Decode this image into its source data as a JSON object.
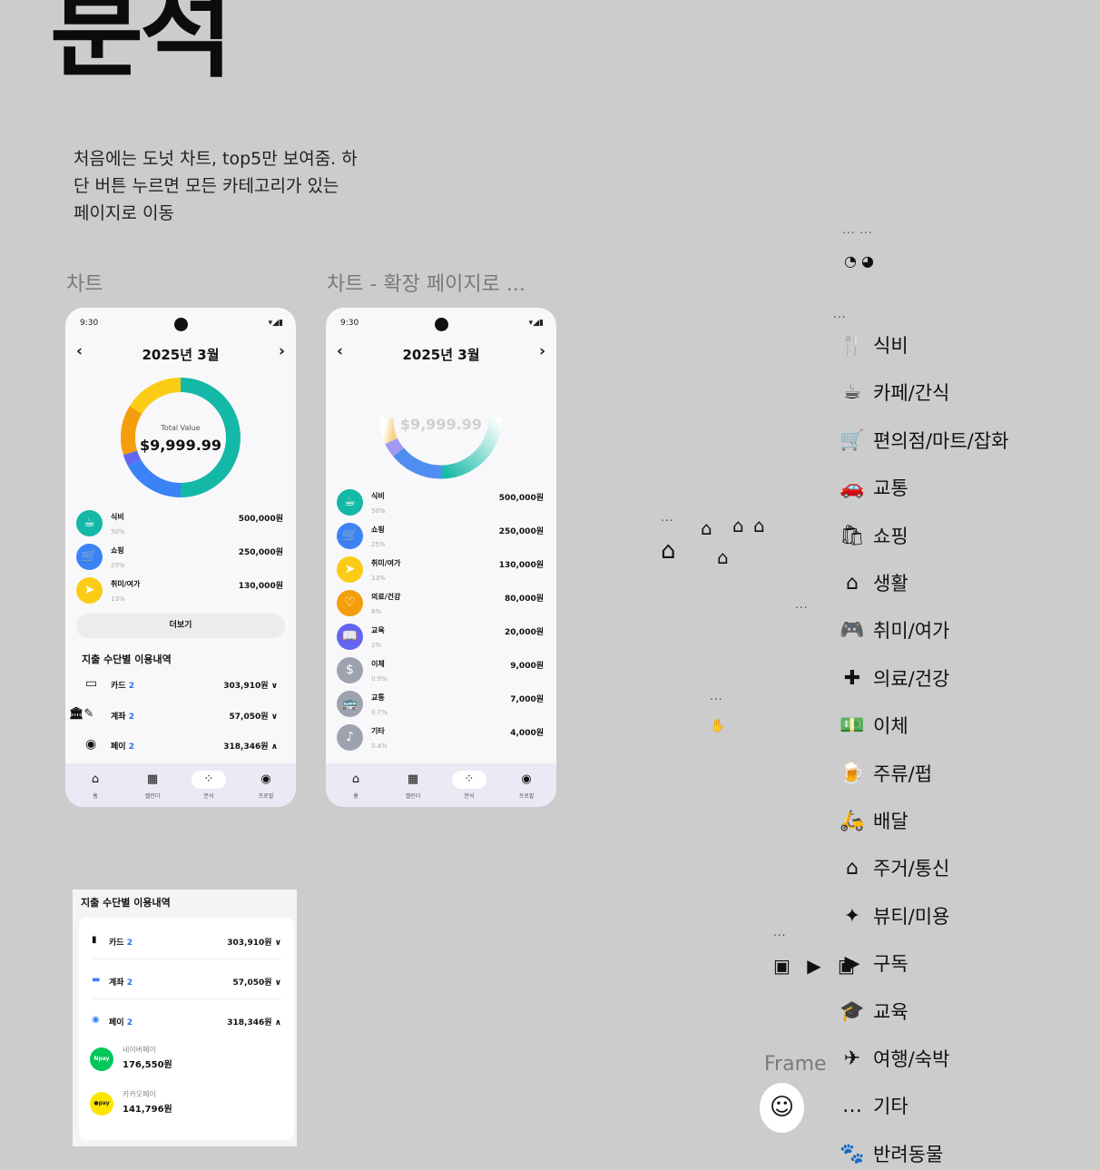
{
  "page": {
    "title": "분석",
    "description": "처음에는 도넛 차트, top5만 보여줌. 하\n단 버튼 누르면 모든 카테고리가 있는\n페이지로 이동",
    "frame1_label": "차트",
    "frame2_label": "차트 - 확장 페이지로 ...",
    "frame3_label": "Frame"
  },
  "status_bar": {
    "time": "9:30",
    "signal": "▾◢▮"
  },
  "screen1": {
    "month_title": "2025년 3월",
    "total_label": "Total Value",
    "total_value": "$9,999.99",
    "categories": [
      {
        "name": "식비",
        "percent": "50%",
        "amount": "500,000원",
        "color": "#14b8a6",
        "icon": "coffee-cup-icon",
        "glyph": "☕"
      },
      {
        "name": "쇼핑",
        "percent": "25%",
        "amount": "250,000원",
        "color": "#3b82f6",
        "icon": "cart-icon",
        "glyph": "🛒"
      },
      {
        "name": "취미/여가",
        "percent": "13%",
        "amount": "130,000원",
        "color": "#facc15",
        "icon": "send-icon",
        "glyph": "➤"
      }
    ],
    "more_button": "더보기",
    "payment_section_title": "지출 수단별 이용내역",
    "payments": [
      {
        "label": "카드",
        "count": "2",
        "amount": "303,910원",
        "chevron": "∨",
        "icon": "card-icon",
        "glyph": "▭"
      },
      {
        "label": "계좌",
        "count": "2",
        "amount": "57,050원",
        "chevron": "∨",
        "icon": "bank-icon",
        "glyph": "🏛"
      },
      {
        "label": "페이",
        "count": "2",
        "amount": "318,346원",
        "chevron": "∧",
        "icon": "pay-icon",
        "glyph": "◉"
      }
    ]
  },
  "screen2": {
    "month_title": "2025년 3월",
    "total_value": "$9,999.99",
    "categories": [
      {
        "name": "식비",
        "percent": "50%",
        "amount": "500,000원",
        "color": "#14b8a6",
        "icon": "coffee-cup-icon",
        "glyph": "☕"
      },
      {
        "name": "쇼핑",
        "percent": "25%",
        "amount": "250,000원",
        "color": "#3b82f6",
        "icon": "cart-icon",
        "glyph": "🛒"
      },
      {
        "name": "취미/여가",
        "percent": "13%",
        "amount": "130,000원",
        "color": "#facc15",
        "icon": "send-icon",
        "glyph": "➤"
      },
      {
        "name": "의료/건강",
        "percent": "8%",
        "amount": "80,000원",
        "color": "#f59e0b",
        "icon": "heart-icon",
        "glyph": "♡"
      },
      {
        "name": "교육",
        "percent": "2%",
        "amount": "20,000원",
        "color": "#6366f1",
        "icon": "book-icon",
        "glyph": "📖"
      },
      {
        "name": "이체",
        "percent": "0.9%",
        "amount": "9,000원",
        "color": "#9ca3af",
        "icon": "dollar-icon",
        "glyph": "$"
      },
      {
        "name": "교통",
        "percent": "0.7%",
        "amount": "7,000원",
        "color": "#9ca3af",
        "icon": "bus-icon",
        "glyph": "🚌"
      },
      {
        "name": "기타",
        "percent": "0.4%",
        "amount": "4,000원",
        "color": "#9ca3af",
        "icon": "guitar-icon",
        "glyph": "♪"
      }
    ]
  },
  "nav": [
    {
      "label": "홈",
      "icon": "home-icon",
      "glyph": "⌂"
    },
    {
      "label": "캘린더",
      "icon": "calendar-icon",
      "glyph": "▦"
    },
    {
      "label": "분석",
      "icon": "analysis-icon",
      "glyph": "⁘"
    },
    {
      "label": "프로필",
      "icon": "profile-icon",
      "glyph": "◉"
    }
  ],
  "payment_card": {
    "title": "지출 수단별 이용내역",
    "rows": [
      {
        "label": "카드",
        "count": "2",
        "amount": "303,910원",
        "chevron": "∨"
      },
      {
        "label": "계좌",
        "count": "2",
        "amount": "57,050원",
        "chevron": "∨"
      },
      {
        "label": "페이",
        "count": "2",
        "amount": "318,346원",
        "chevron": "∧"
      }
    ],
    "sub_items": [
      {
        "name": "네이버페이",
        "amount": "176,550원",
        "badge": "Npay",
        "color": "#03c75a"
      },
      {
        "name": "카카오페이",
        "amount": "141,796원",
        "badge": "●pay",
        "color": "#fee500"
      }
    ]
  },
  "category_list": [
    {
      "name": "식비",
      "icon": "fork-knife-icon",
      "glyph": "🍴"
    },
    {
      "name": "카페/간식",
      "icon": "coffee-icon",
      "glyph": "☕"
    },
    {
      "name": "편의점/마트/잡화",
      "icon": "cart-icon",
      "glyph": "🛒"
    },
    {
      "name": "교통",
      "icon": "car-icon",
      "glyph": "🚗"
    },
    {
      "name": "쇼핑",
      "icon": "shopping-bag-icon",
      "glyph": "🛍"
    },
    {
      "name": "생활",
      "icon": "hanger-house-icon",
      "glyph": "⌂"
    },
    {
      "name": "취미/여가",
      "icon": "gamepad-icon",
      "glyph": "🎮"
    },
    {
      "name": "의료/건강",
      "icon": "bandage-icon",
      "glyph": "✚"
    },
    {
      "name": "이체",
      "icon": "money-icon",
      "glyph": "💵"
    },
    {
      "name": "주류/펍",
      "icon": "beer-icon",
      "glyph": "🍺"
    },
    {
      "name": "배달",
      "icon": "scooter-icon",
      "glyph": "🛵"
    },
    {
      "name": "주거/통신",
      "icon": "house-icon",
      "glyph": "⌂"
    },
    {
      "name": "뷰티/미용",
      "icon": "sparkle-icon",
      "glyph": "✦"
    },
    {
      "name": "구독",
      "icon": "subscription-icon",
      "glyph": "▶"
    },
    {
      "name": "교육",
      "icon": "graduation-cap-icon",
      "glyph": "🎓"
    },
    {
      "name": "여행/숙박",
      "icon": "airplane-icon",
      "glyph": "✈"
    },
    {
      "name": "기타",
      "icon": "more-icon",
      "glyph": "…"
    },
    {
      "name": "반려동물",
      "icon": "paw-icon",
      "glyph": "🐾"
    }
  ],
  "misc": {
    "ellipsis": "...",
    "ellipsis_pair": "... ...",
    "pie_glyphs": "◔ ◕",
    "hanger_glyph": "⌂",
    "hand_glyph": "✋",
    "video_glyphs": "▣ ▶ ▣",
    "avatar_glyph": "☺"
  }
}
